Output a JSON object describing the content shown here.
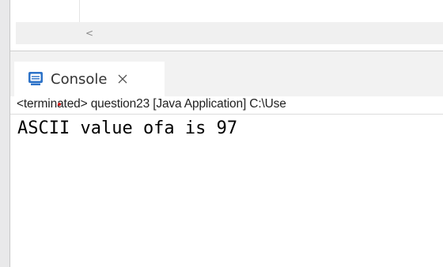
{
  "editor": {
    "scroll_left_glyph": "<"
  },
  "console": {
    "tab_label": "Console",
    "tab_close_icon": "close-icon",
    "icon": "console-icon",
    "status": "<terminated> question23 [Java Application] C:\\Use",
    "output_line": "ASCII value ofa is 97"
  },
  "colors": {
    "console_icon_blue": "#2d73c8",
    "terminated_marker": "#d21f1f"
  }
}
